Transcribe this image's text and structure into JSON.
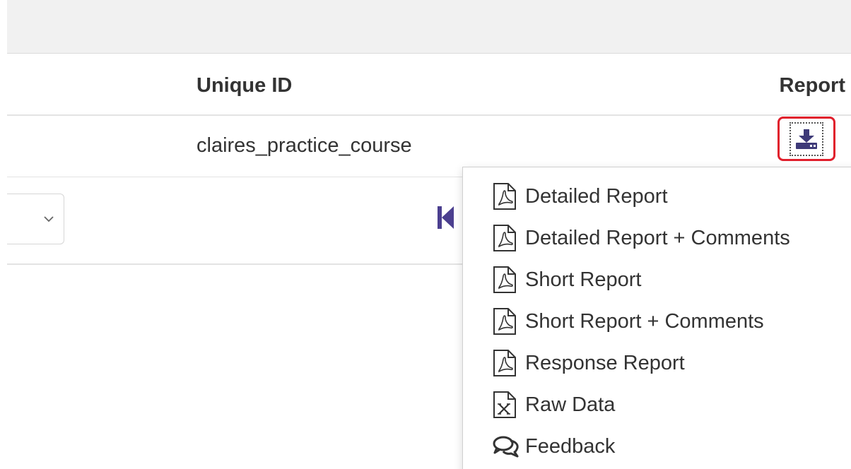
{
  "table": {
    "headers": {
      "unique_id": "Unique ID",
      "report": "Report"
    },
    "rows": [
      {
        "unique_id": "claires_practice_course"
      }
    ]
  },
  "report_menu": {
    "items": [
      {
        "label": "Detailed Report",
        "icon": "pdf-file-icon"
      },
      {
        "label": "Detailed Report + Comments",
        "icon": "pdf-file-icon"
      },
      {
        "label": "Short Report",
        "icon": "pdf-file-icon"
      },
      {
        "label": "Short Report + Comments",
        "icon": "pdf-file-icon"
      },
      {
        "label": "Response Report",
        "icon": "pdf-file-icon"
      },
      {
        "label": "Raw Data",
        "icon": "excel-file-icon"
      },
      {
        "label": "Feedback",
        "icon": "comments-icon"
      }
    ]
  },
  "colors": {
    "accent": "#3e3a78",
    "highlight_border": "#e01e2c",
    "text": "#333333"
  }
}
